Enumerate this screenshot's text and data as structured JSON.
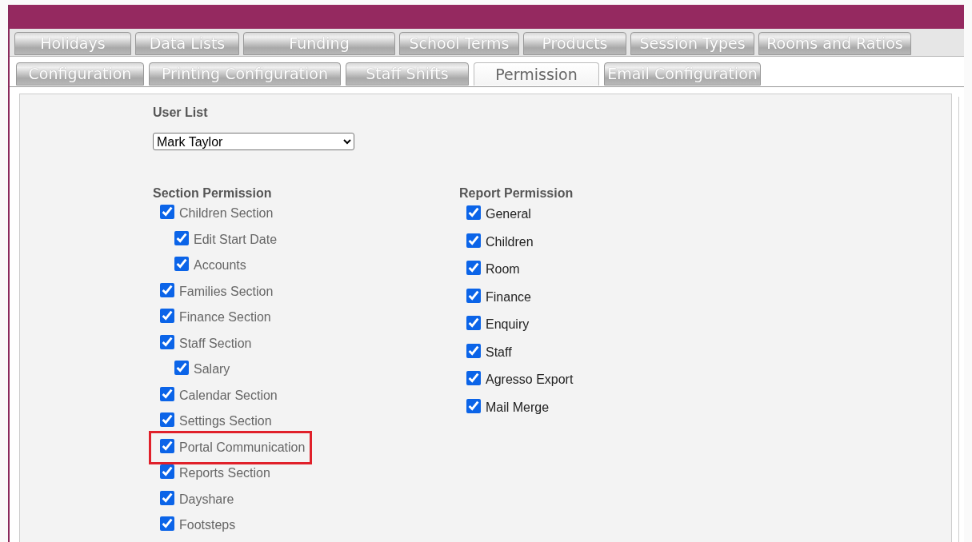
{
  "tab_rows": [
    [
      {
        "label": "Holidays",
        "selected": false
      },
      {
        "label": "Data Lists",
        "selected": false
      },
      {
        "label": "Funding",
        "selected": false
      },
      {
        "label": "School Terms",
        "selected": false
      },
      {
        "label": "Products",
        "selected": false
      },
      {
        "label": "Session Types",
        "selected": false
      },
      {
        "label": "Rooms and Ratios",
        "selected": false
      }
    ],
    [
      {
        "label": "Configuration",
        "selected": false
      },
      {
        "label": "Printing Configuration",
        "selected": false
      },
      {
        "label": "Staff Shifts",
        "selected": false
      },
      {
        "label": "Permission",
        "selected": true
      },
      {
        "label": "Email Configuration",
        "selected": false
      }
    ]
  ],
  "user_list": {
    "label": "User List",
    "value": "Mark Taylor"
  },
  "section_permission": {
    "title": "Section Permission",
    "items": [
      {
        "label": "Children Section",
        "checked": true,
        "highlighted": false,
        "children": [
          {
            "label": "Edit Start Date",
            "checked": true,
            "highlighted": false
          },
          {
            "label": "Accounts",
            "checked": true,
            "highlighted": false
          }
        ]
      },
      {
        "label": "Families Section",
        "checked": true,
        "highlighted": false
      },
      {
        "label": "Finance Section",
        "checked": true,
        "highlighted": false
      },
      {
        "label": "Staff Section",
        "checked": true,
        "highlighted": false,
        "children": [
          {
            "label": "Salary",
            "checked": true,
            "highlighted": false
          }
        ]
      },
      {
        "label": "Calendar Section",
        "checked": true,
        "highlighted": false
      },
      {
        "label": "Settings Section",
        "checked": true,
        "highlighted": false
      },
      {
        "label": "Portal Communication",
        "checked": true,
        "highlighted": true
      },
      {
        "label": "Reports Section",
        "checked": true,
        "highlighted": false
      },
      {
        "label": "Dayshare",
        "checked": true,
        "highlighted": false
      },
      {
        "label": "Footsteps",
        "checked": true,
        "highlighted": false
      }
    ]
  },
  "report_permission": {
    "title": "Report Permission",
    "items": [
      {
        "label": "General",
        "checked": true
      },
      {
        "label": "Children",
        "checked": true
      },
      {
        "label": "Room",
        "checked": true
      },
      {
        "label": "Finance",
        "checked": true
      },
      {
        "label": "Enquiry",
        "checked": true
      },
      {
        "label": "Staff",
        "checked": true
      },
      {
        "label": "Agresso Export",
        "checked": true
      },
      {
        "label": "Mail Merge",
        "checked": true
      }
    ]
  }
}
